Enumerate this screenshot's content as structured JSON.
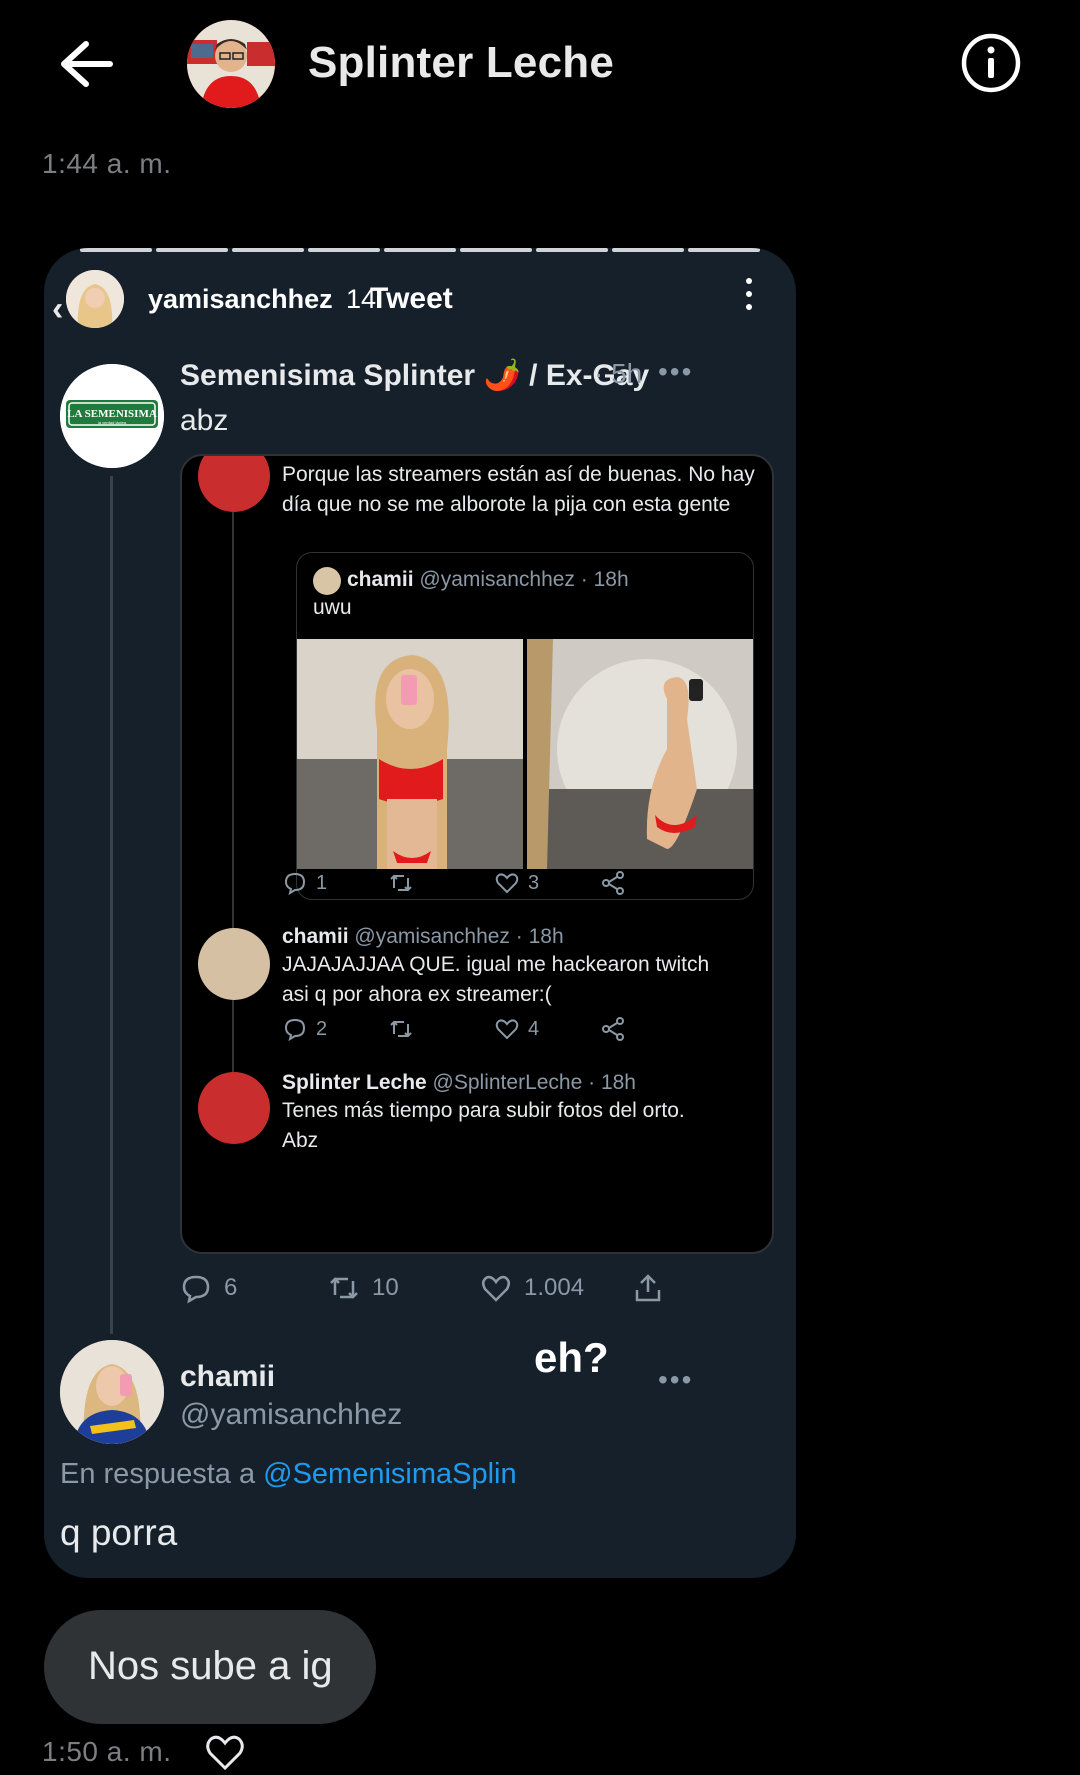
{
  "header": {
    "title": "Splinter Leche",
    "back_icon": "arrow-left-icon",
    "info_icon": "info-icon"
  },
  "timestamps": {
    "first": "1:44 a. m.",
    "second": "1:50 a. m."
  },
  "shared_screenshot": {
    "story_user": "yamisanchhez",
    "story_time": "14",
    "story_title": "Tweet",
    "original_tweet": {
      "author": "Semenisima Splinter",
      "pepper": "🌶️",
      "author_suffix": "/ Ex-Gay",
      "time": "· 5h",
      "text": "abz",
      "avatar_label": "LA SEMENISIMA",
      "avatar_sub": "la verdad láctea"
    },
    "embedded": {
      "top_text": "Porque las streamers están así de buenas. No hay día que no se me alborote la pija con esta gente",
      "quote": {
        "name": "chamii",
        "handle": "@yamisanchhez · 18h",
        "text": "uwu"
      },
      "actions1": {
        "reply": "1",
        "like": "3"
      },
      "reply1": {
        "name": "chamii",
        "handle": "@yamisanchhez · 18h",
        "text": "JAJAJAJJAA QUE. igual me hackearon twitch asi q por ahora ex streamer:("
      },
      "actions2": {
        "reply": "2",
        "like": "4"
      },
      "reply2": {
        "name": "Splinter Leche",
        "handle": "@SplinterLeche · 18h",
        "text": "Tenes más tiempo para subir fotos del orto. Abz"
      }
    },
    "tweet_actions": {
      "replies": "6",
      "retweets": "10",
      "likes": "1.004"
    },
    "reply": {
      "name": "chamii",
      "handle": "@yamisanchhez",
      "overlay_note": "eh?",
      "in_reply_prefix": "En respuesta a",
      "in_reply_handle": "@SemenisimaSplin",
      "text": "q porra"
    }
  },
  "message": {
    "text": "Nos sube a ig"
  },
  "colors": {
    "background": "#000000",
    "card": "#15202b",
    "link": "#1d9bf0",
    "muted": "#8b98a5",
    "bubble": "#2f3336"
  }
}
